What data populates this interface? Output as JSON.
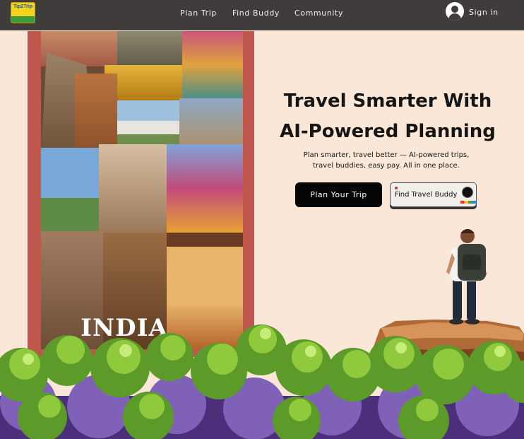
{
  "nav": {
    "logo_text": "Tip2Trip",
    "links": [
      {
        "label": "Plan Trip"
      },
      {
        "label": "Find Buddy"
      },
      {
        "label": "Community"
      }
    ],
    "signin_label": "Sign in"
  },
  "hero": {
    "collage_label": "INDIA",
    "headline_line1": "Travel Smarter With",
    "headline_line2": "AI-Powered Planning",
    "subtext_line1": "Plan smarter, travel better — AI-powered trips,",
    "subtext_line2": "travel buddies, easy pay. All in one place.",
    "primary_button": "Plan Your Trip",
    "secondary_button": "Find Travel Buddy"
  },
  "icons": {
    "user": "user-icon",
    "camera": "camera-lens-icon"
  },
  "colors": {
    "nav_bg": "#3f3c3b",
    "page_bg": "#fbe7d8",
    "frame": "#c0574d",
    "primary_btn": "#050505"
  }
}
